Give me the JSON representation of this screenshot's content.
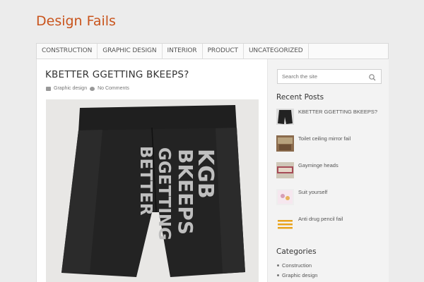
{
  "site": {
    "title": "Design Fails"
  },
  "nav": {
    "items": [
      "CONSTRUCTION",
      "GRAPHIC DESIGN",
      "INTERIOR",
      "PRODUCT",
      "UNCATEGORIZED"
    ]
  },
  "post": {
    "title": "KBETTER GGETTING BKEEPS?",
    "category": "Graphic design",
    "comments": "No Comments",
    "image_text": [
      "KGB",
      "BKEEPS",
      "GGETTING",
      "BETTER"
    ]
  },
  "sidebar": {
    "search_placeholder": "Search the site",
    "recent_title": "Recent Posts",
    "recent": [
      {
        "label": "KBETTER GGETTING BKEEPS?"
      },
      {
        "label": "Toilet ceiling mirror fail"
      },
      {
        "label": "Gayminge heads"
      },
      {
        "label": "Suit yourself"
      },
      {
        "label": "Anti drug pencil fail"
      }
    ],
    "categories_title": "Categories",
    "categories": [
      "Construction",
      "Graphic design"
    ]
  },
  "colors": {
    "accent": "#c9541c",
    "background": "#ececec"
  }
}
